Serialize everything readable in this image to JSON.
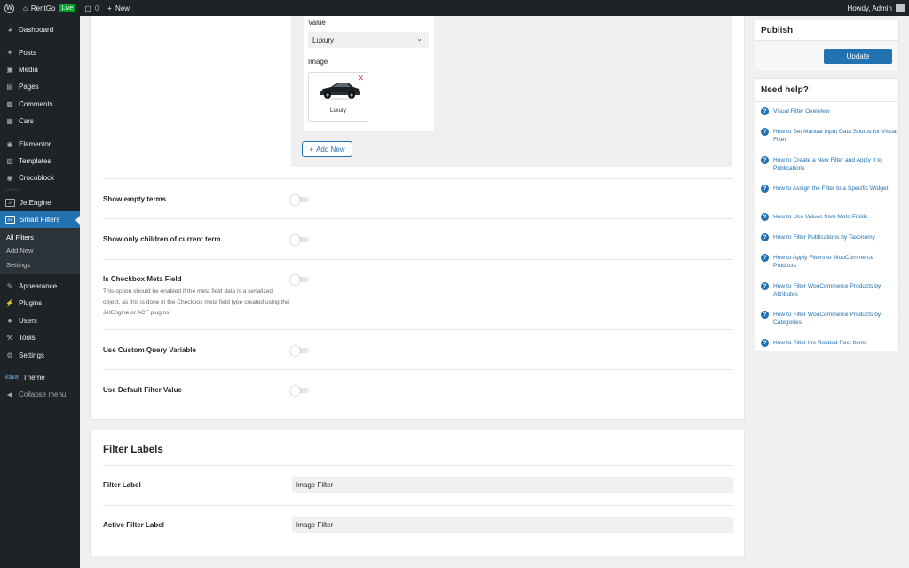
{
  "adminbar": {
    "site_name": "RentGo",
    "live_badge": "Live",
    "comments_count": "0",
    "new_label": "New",
    "howdy": "Howdy, Admin"
  },
  "sidebar": {
    "items_top": [
      {
        "label": "Dashboard",
        "icon": "dashboard-icon"
      },
      {
        "label": "Posts",
        "icon": "pin-icon"
      },
      {
        "label": "Media",
        "icon": "media-icon"
      },
      {
        "label": "Pages",
        "icon": "page-icon"
      },
      {
        "label": "Comments",
        "icon": "comment-icon"
      },
      {
        "label": "Cars",
        "icon": "car-icon"
      },
      {
        "label": "Elementor",
        "icon": "elementor-icon"
      },
      {
        "label": "Templates",
        "icon": "folder-icon"
      },
      {
        "label": "Crocoblock",
        "icon": "crocoblock-icon"
      }
    ],
    "crocoblock_separator": "CROCO",
    "jetengine_label": "JetEngine",
    "smart_filters_label": "Smart Filters",
    "submenu": [
      "All Filters",
      "Add New",
      "Settings"
    ],
    "items_bottom": [
      {
        "label": "Appearance",
        "icon": "appearance-icon"
      },
      {
        "label": "Plugins",
        "icon": "plugin-icon"
      },
      {
        "label": "Users",
        "icon": "users-icon"
      },
      {
        "label": "Tools",
        "icon": "tools-icon"
      },
      {
        "label": "Settings",
        "icon": "settings-icon"
      }
    ],
    "kava_logo": "kava",
    "theme_label": "Theme",
    "collapse_label": "Collapse menu"
  },
  "repeater": {
    "value_label": "Value",
    "value_selected": "Luxury",
    "image_label": "Image",
    "image_caption": "Luxury",
    "add_new_label": "Add New"
  },
  "settings": {
    "show_empty_terms": "Show empty terms",
    "show_only_children": "Show only children of current term",
    "checkbox_meta_field": "Is Checkbox Meta Field",
    "checkbox_meta_desc": "This option should be enabled if the meta field data is a serialized object, as this is done in the Checkbox meta field type created using the JetEngine or ACF plugins.",
    "custom_query_var": "Use Custom Query Variable",
    "default_filter_value": "Use Default Filter Value"
  },
  "filter_labels": {
    "title": "Filter Labels",
    "filter_label_caption": "Filter Label",
    "filter_label_value": "Image Filter",
    "active_filter_label_caption": "Active Filter Label",
    "active_filter_label_value": "Image Filter"
  },
  "publish": {
    "title": "Publish",
    "update_label": "Update"
  },
  "help": {
    "title": "Need help?",
    "links": [
      "Visual Filter Overview",
      "How to Set Manual Input Data Source for Visual Filter",
      "How to Create a New Filter and Apply It to Publications",
      "How to Assign the Filter to a Specific Widget",
      "How to Use Values from Meta Fields",
      "How to Filter Publications by Taxonomy",
      "How to Apply Filters to WooCommerce Products",
      "How to Filter WooCommerce Products by Attributes",
      "How to Filter WooCommerce Products by Categories",
      "How to Filter the Related Post Items"
    ]
  },
  "colors": {
    "accent": "#2271b1",
    "admin_dark": "#1d2327",
    "live_green": "#00a32a",
    "remove_red": "#d63638"
  }
}
